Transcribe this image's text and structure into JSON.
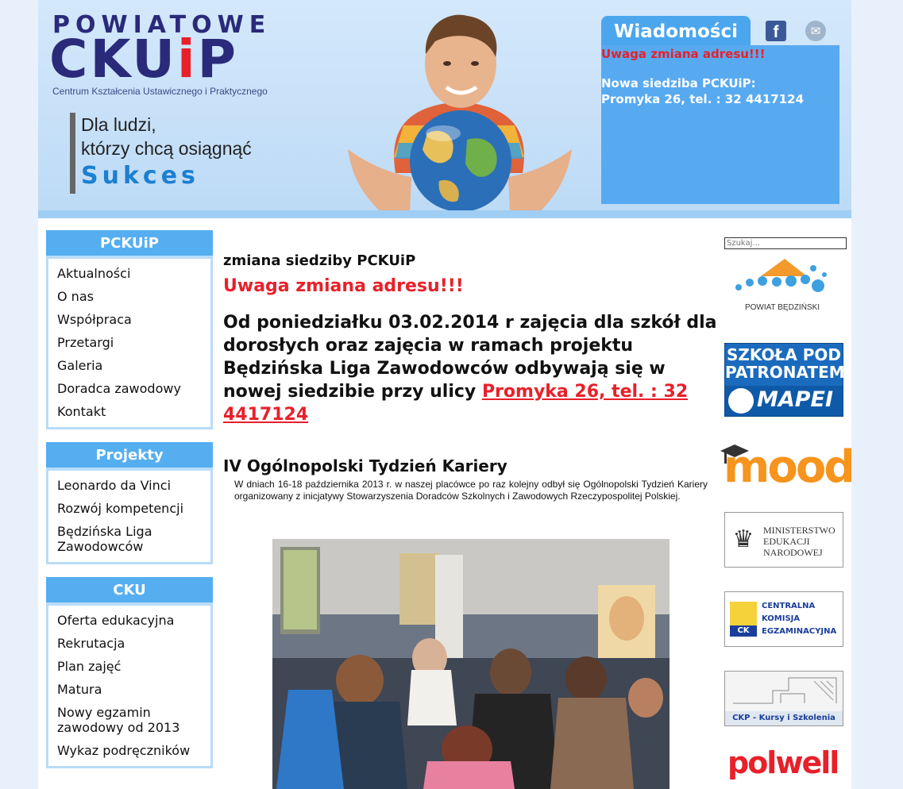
{
  "logo": {
    "top": "POWIATOWE",
    "main_prefix": "C",
    "main_k": "K",
    "main_u": "U",
    "main_i": "i",
    "main_p": "P",
    "subtitle": "Centrum Kształcenia Ustawicznego i Praktycznego"
  },
  "slogan": {
    "line1": "Dla ludzi,",
    "line2": "którzy chcą osiągnąć",
    "line3": "Sukces"
  },
  "news": {
    "tab": "Wiadomości",
    "alert": "Uwaga zmiana adresu!!!",
    "line1": "Nowa siedziba PCKUiP:",
    "line2": "Promyka 26, tel. : 32 4417124"
  },
  "social": {
    "facebook": "f",
    "mail": "✉"
  },
  "sidebar": {
    "pckuip": {
      "title": "PCKUiP",
      "items": [
        "Aktualności",
        "O nas",
        "Współpraca",
        "Przetargi",
        "Galeria",
        "Doradca zawodowy",
        "Kontakt"
      ]
    },
    "projekty": {
      "title": "Projekty",
      "items": [
        "Leonardo da Vinci",
        "Rozwój kompetencji",
        "Będzińska Liga Zawodowców"
      ]
    },
    "cku": {
      "title": "CKU",
      "items": [
        "Oferta edukacyjna",
        "Rekrutacja",
        "Plan zajęć",
        "Matura",
        "Nowy egzamin zawodowy od 2013",
        "Wykaz podręczników"
      ]
    }
  },
  "main": {
    "post1_title": "zmiana siedziby PCKUiP",
    "post1_alert": "Uwaga zmiana adresu!!!",
    "post1_body": "Od poniedziałku 03.02.2014 r zajęcia dla szkół dla dorosłych oraz zajęcia w ramach projektu Będzińska Liga Zawodowców odbywają się w nowej siedzibie przy ulicy ",
    "post1_link": "Promyka 26, tel. : 32 4417124",
    "post2_title": "IV Ogólnopolski Tydzień Kariery",
    "post2_body": "W dniach 16-18 października 2013 r. w naszej placówce po raz kolejny odbył się Ogólnopolski Tydzień Kariery organizowany z inicjatywy Stowarzyszenia Doradców Szkolnych i Zawodowych Rzeczypospolitej Polskiej."
  },
  "search": {
    "placeholder": "Szukaj..."
  },
  "partners": {
    "powiat": "POWIAT BĘDZIŃSKI",
    "mapei_line1": "SZKOŁA POD",
    "mapei_line2": "PATRONATEM",
    "mapei_brand": "MAPEI",
    "moodle": "moodle",
    "men_line1": "MINISTERSTWO",
    "men_line2": "EDUKACJI",
    "men_line3": "NARODOWEJ",
    "cke_badge": "CK",
    "cke_line1": "CENTRALNA",
    "cke_line2": "KOMISJA",
    "cke_line3": "EGZAMINACYJNA",
    "ckp": "CKP - Kursy i Szkolenia",
    "polwell": "polwell"
  },
  "colors": {
    "accent": "#55aef0",
    "alert": "#e8202a",
    "navy": "#2a2a7a"
  }
}
